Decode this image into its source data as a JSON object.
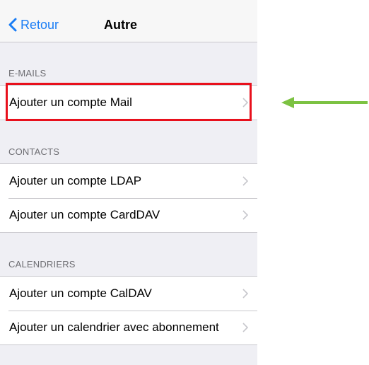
{
  "navbar": {
    "back_label": "Retour",
    "title": "Autre"
  },
  "sections": [
    {
      "header": "E-MAILS",
      "rows": [
        {
          "label": "Ajouter un compte Mail"
        }
      ]
    },
    {
      "header": "CONTACTS",
      "rows": [
        {
          "label": "Ajouter un compte LDAP"
        },
        {
          "label": "Ajouter un compte CardDAV"
        }
      ]
    },
    {
      "header": "CALENDRIERS",
      "rows": [
        {
          "label": "Ajouter un compte CalDAV"
        },
        {
          "label": "Ajouter un calendrier avec abonnement"
        }
      ]
    }
  ],
  "colors": {
    "accent": "#1a7df5",
    "highlight_box": "#e8101c",
    "arrow": "#7cc242",
    "background": "#efeff4"
  },
  "icons": {
    "back": "chevron-left-icon",
    "disclosure": "chevron-right-icon",
    "annotation": "arrow-left-icon"
  }
}
